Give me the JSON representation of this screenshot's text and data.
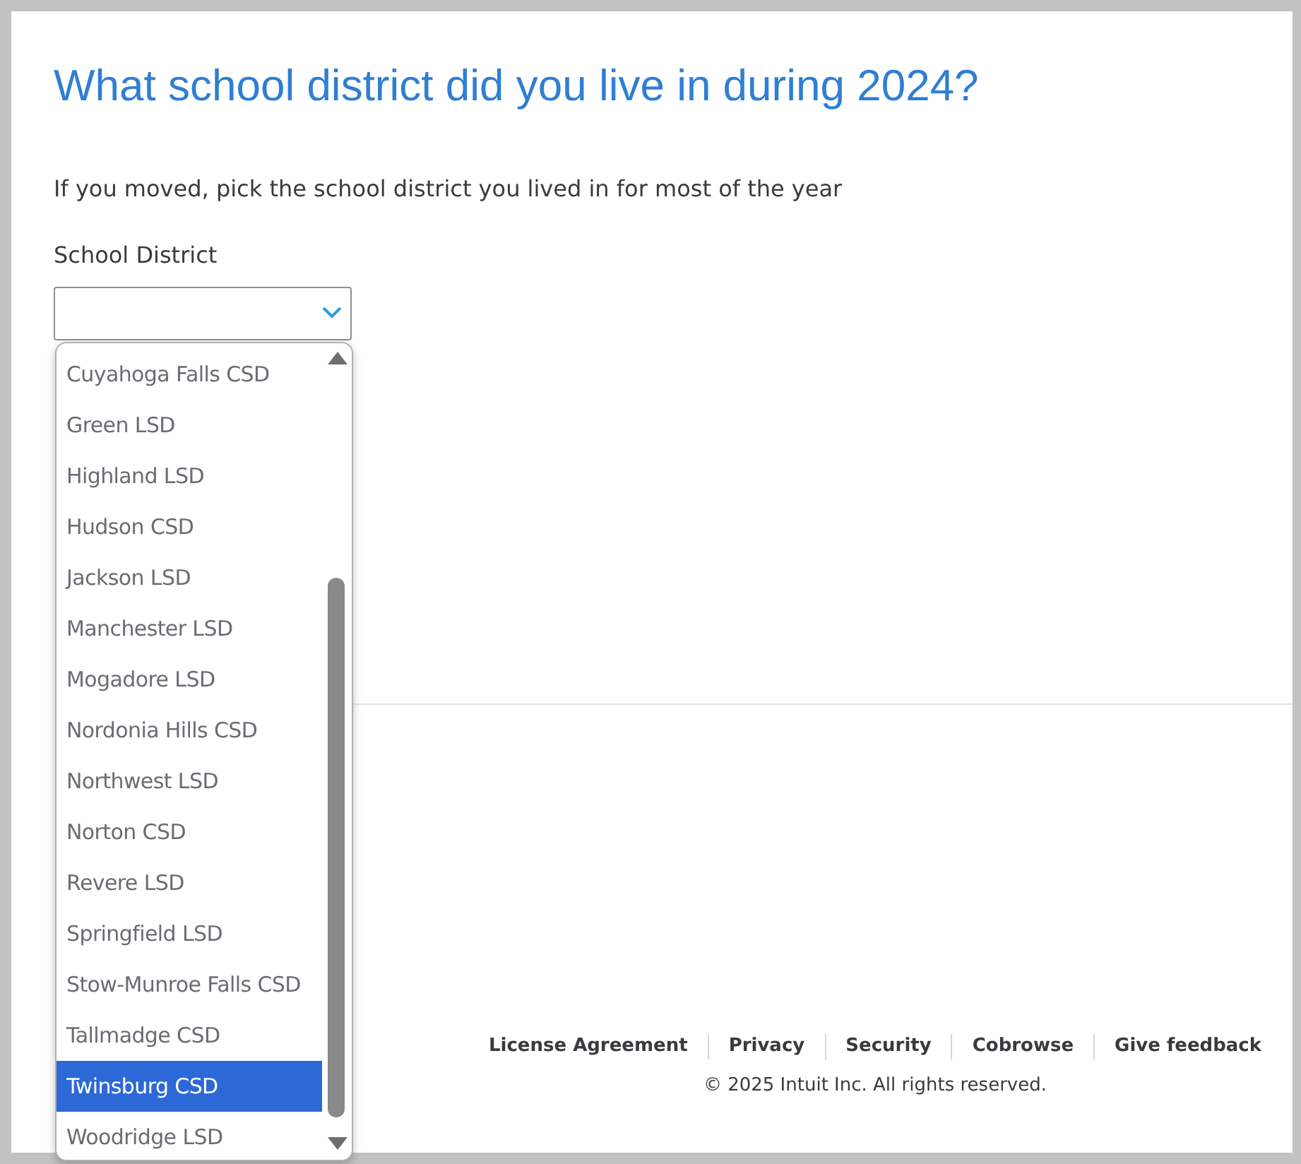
{
  "heading": "What school district did you live in during 2024?",
  "subtitle": "If you moved, pick the school district you lived in for most of the year",
  "field": {
    "label": "School District",
    "expanded": true
  },
  "options": [
    {
      "label": "Cuyahoga Falls CSD",
      "selected": false
    },
    {
      "label": "Green LSD",
      "selected": false
    },
    {
      "label": "Highland LSD",
      "selected": false
    },
    {
      "label": "Hudson CSD",
      "selected": false
    },
    {
      "label": "Jackson LSD",
      "selected": false
    },
    {
      "label": "Manchester LSD",
      "selected": false
    },
    {
      "label": "Mogadore LSD",
      "selected": false
    },
    {
      "label": "Nordonia Hills CSD",
      "selected": false
    },
    {
      "label": "Northwest LSD",
      "selected": false
    },
    {
      "label": "Norton CSD",
      "selected": false
    },
    {
      "label": "Revere LSD",
      "selected": false
    },
    {
      "label": "Springfield LSD",
      "selected": false
    },
    {
      "label": "Stow-Munroe Falls CSD",
      "selected": false
    },
    {
      "label": "Tallmadge CSD",
      "selected": false
    },
    {
      "label": "Twinsburg CSD",
      "selected": true
    },
    {
      "label": "Woodridge LSD",
      "selected": false
    }
  ],
  "footer": {
    "links": [
      "License Agreement",
      "Privacy",
      "Security",
      "Cobrowse",
      "Give feedback"
    ],
    "copyright": "© 2025 Intuit Inc. All rights reserved."
  }
}
